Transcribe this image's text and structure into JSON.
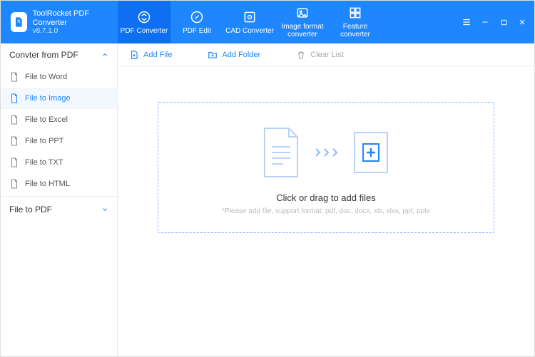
{
  "app": {
    "title": "ToolRocket PDF Converter",
    "version": "v8.7.1.0"
  },
  "tabs": [
    {
      "label": "PDF Converter",
      "active": true
    },
    {
      "label": "PDF Edit",
      "active": false
    },
    {
      "label": "CAD Converter",
      "active": false
    },
    {
      "label": "Image format converter",
      "active": false
    },
    {
      "label": "Feature converter",
      "active": false
    }
  ],
  "sidebar": {
    "group1": {
      "title": "Convter from PDF",
      "items": [
        {
          "label": "File to Word",
          "active": false
        },
        {
          "label": "File to Image",
          "active": true
        },
        {
          "label": "File to Excel",
          "active": false
        },
        {
          "label": "File to PPT",
          "active": false
        },
        {
          "label": "File to TXT",
          "active": false
        },
        {
          "label": "File to HTML",
          "active": false
        }
      ]
    },
    "group2": {
      "title": "File to PDF"
    }
  },
  "toolbar": {
    "add_file": "Add File",
    "add_folder": "Add Folder",
    "clear_list": "Clear List"
  },
  "dropzone": {
    "title": "Click or drag to add files",
    "subtitle": "*Please add file, support format: pdf, doc, docx, xls, xlxs, ppt, pptx"
  }
}
